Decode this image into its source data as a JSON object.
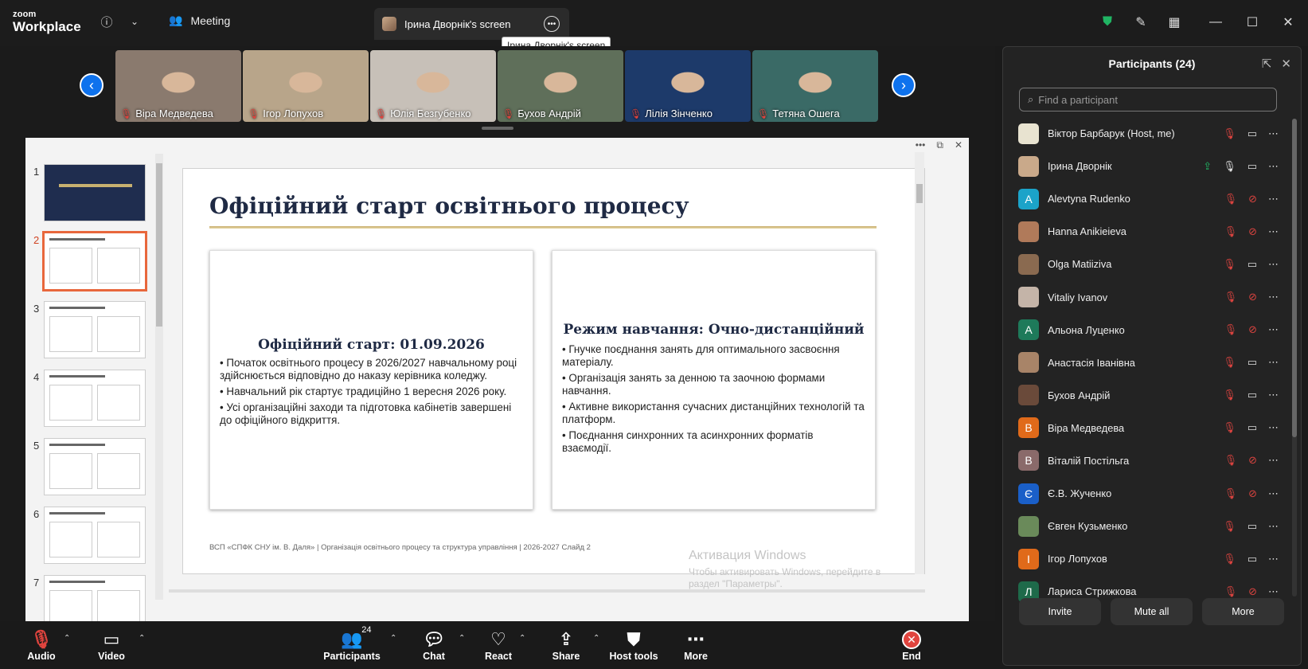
{
  "titlebar": {
    "logo_line1": "zoom",
    "logo_line2": "Workplace",
    "meeting_label": "Meeting",
    "screen_tab_label": "Ірина Дворнік's screen",
    "tooltip": "Ірина Дворнік's screen"
  },
  "gallery": {
    "tiles": [
      {
        "name": "Віра Медведева",
        "bg": "#8a7a6e"
      },
      {
        "name": "Ігор Лопухов",
        "bg": "#b8a58a"
      },
      {
        "name": "Юлія Безгубенко",
        "bg": "#c7c0b8"
      },
      {
        "name": "Бухов Андрій",
        "bg": "#5f6f5a"
      },
      {
        "name": "Лілія Зінченко",
        "bg": "#1d3a6a"
      },
      {
        "name": "Тетяна Ошега",
        "bg": "#3a6a66"
      }
    ]
  },
  "slides": {
    "thumbs": [
      "1",
      "2",
      "3",
      "4",
      "5",
      "6",
      "7"
    ],
    "current": "2",
    "title": "Офіційний старт освітнього процесу",
    "card1_title": "Офіційний старт: 01.09.2026",
    "card1_items": [
      "• Початок освітнього процесу в 2026/2027 навчальному році здійснюється відповідно до наказу керівника коледжу.",
      "• Навчальний рік стартує традиційно 1 вересня 2026 року.",
      "• Усі організаційні заходи та підготовка кабінетів завершені до офіційного відкриття."
    ],
    "card2_title": "Режим навчання: Очно-дистанційний",
    "card2_items": [
      "• Гнучке поєднання занять для оптимального засвоєння матеріалу.",
      "• Організація занять за денною та заочною формами навчання.",
      "• Активне використання сучасних дистанційних технологій та платформ.",
      "• Поєднання синхронних та асинхронних форматів взаємодії."
    ],
    "footer": "ВСП «СПФК СНУ ім. В. Даля»  |  Організація освітнього процесу та структура управління  |  2026-2027      Слайд 2"
  },
  "watermark": {
    "line1": "Активация Windows",
    "line2": "Чтобы активировать Windows, перейдите в",
    "line3": "раздел \"Параметры\"."
  },
  "participants": {
    "header": "Participants (24)",
    "search_placeholder": "Find a participant",
    "list": [
      {
        "name": "Віктор Барбарук (Host, me)",
        "initial": "",
        "color": "#e8e3d0",
        "mic": "off",
        "video": "on"
      },
      {
        "name": "Ірина Дворнік",
        "initial": "",
        "color": "#c9a98a",
        "mic": "on",
        "video": "on",
        "share": true
      },
      {
        "name": "Alevtyna Rudenko",
        "initial": "A",
        "color": "#1ba3c9",
        "mic": "off",
        "video": "off"
      },
      {
        "name": "Hanna Anikieieva",
        "initial": "",
        "color": "#b07a5a",
        "mic": "off",
        "video": "off"
      },
      {
        "name": "Olga Matiiziva",
        "initial": "",
        "color": "#8a6a50",
        "mic": "off",
        "video": "on"
      },
      {
        "name": "Vitaliy Ivanov",
        "initial": "",
        "color": "#c4b4a8",
        "mic": "off",
        "video": "off"
      },
      {
        "name": "Альона Луценко",
        "initial": "А",
        "color": "#1e7a5a",
        "mic": "off",
        "video": "off"
      },
      {
        "name": "Анастасія Іванівна",
        "initial": "",
        "color": "#a88468",
        "mic": "off",
        "video": "on"
      },
      {
        "name": "Бухов Андрій",
        "initial": "",
        "color": "#6a4a3a",
        "mic": "off",
        "video": "on"
      },
      {
        "name": "Віра Медведева",
        "initial": "В",
        "color": "#e06a1a",
        "mic": "off",
        "video": "on"
      },
      {
        "name": "Віталій Постільга",
        "initial": "В",
        "color": "#8a6a6a",
        "mic": "off",
        "video": "off"
      },
      {
        "name": "Є.В. Жученко",
        "initial": "Є",
        "color": "#1a5fc8",
        "mic": "off",
        "video": "off"
      },
      {
        "name": "Євген Кузьменко",
        "initial": "",
        "color": "#6a8a5a",
        "mic": "off",
        "video": "on"
      },
      {
        "name": "Ігор Лопухов",
        "initial": "І",
        "color": "#e06a1a",
        "mic": "off",
        "video": "on"
      },
      {
        "name": "Лариса Стрижкова",
        "initial": "Л",
        "color": "#1e6a4a",
        "mic": "off",
        "video": "off"
      }
    ],
    "buttons": {
      "invite": "Invite",
      "mute_all": "Mute all",
      "more": "More"
    }
  },
  "toolbar": {
    "audio": "Audio",
    "video": "Video",
    "participants": "Participants",
    "participants_count": "24",
    "chat": "Chat",
    "react": "React",
    "share": "Share",
    "host_tools": "Host tools",
    "more": "More",
    "end": "End"
  }
}
